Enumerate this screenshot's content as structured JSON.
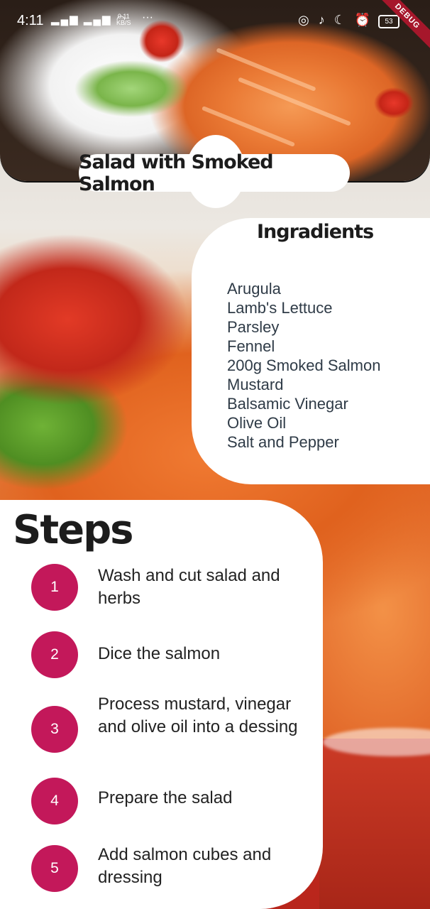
{
  "status_bar": {
    "time": "4:11",
    "net_speed_value": "0.11",
    "net_speed_unit": "KB/S",
    "battery": "53",
    "debug_label": "DEBUG"
  },
  "recipe": {
    "title": "Salad with Smoked Salmon"
  },
  "ingredients": {
    "heading": "Ingradients",
    "items": [
      "Arugula",
      "Lamb's Lettuce",
      "Parsley",
      "Fennel",
      "200g Smoked Salmon",
      "Mustard",
      "Balsamic Vinegar",
      "Olive Oil",
      "Salt and Pepper"
    ]
  },
  "steps": {
    "heading": "Steps",
    "items": [
      {
        "number": "1",
        "text": "Wash and cut salad and herbs"
      },
      {
        "number": "2",
        "text": "Dice the salmon"
      },
      {
        "number": "3",
        "text": "Process mustard, vinegar and olive oil into a dessing"
      },
      {
        "number": "4",
        "text": "Prepare the salad"
      },
      {
        "number": "5",
        "text": "Add salmon cubes and dressing"
      }
    ]
  },
  "colors": {
    "step_accent": "#c3185a",
    "card_bg": "#ffffff",
    "ingredient_text": "#2f3b47"
  }
}
